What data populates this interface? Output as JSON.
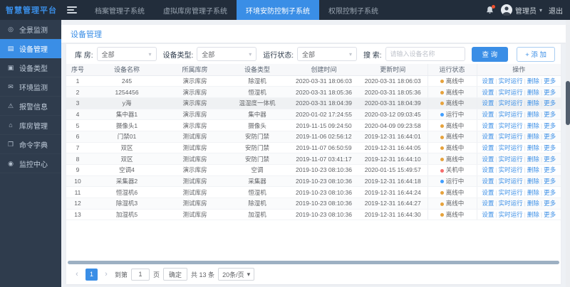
{
  "topbar": {
    "logo": "智慧管理平台",
    "tabs": [
      {
        "label": "档案管理子系统",
        "active": false
      },
      {
        "label": "虚拟库房管理子系统",
        "active": false
      },
      {
        "label": "环境安防控制子系统",
        "active": true
      },
      {
        "label": "权限控制子系统",
        "active": false
      }
    ],
    "user_name": "管理员",
    "caret": "▾",
    "logout": "退出"
  },
  "sidebar": {
    "items": [
      {
        "label": "全景监测",
        "icon": "panorama-icon",
        "glyph": "◎",
        "active": false
      },
      {
        "label": "设备管理",
        "icon": "device-manage-icon",
        "glyph": "▤",
        "active": true
      },
      {
        "label": "设备类型",
        "icon": "device-type-icon",
        "glyph": "▣",
        "active": false
      },
      {
        "label": "环境监测",
        "icon": "environment-icon",
        "glyph": "✉",
        "active": false
      },
      {
        "label": "报警信息",
        "icon": "alarm-icon",
        "glyph": "⚠",
        "active": false
      },
      {
        "label": "库房管理",
        "icon": "warehouse-icon",
        "glyph": "⌂",
        "active": false
      },
      {
        "label": "命令字典",
        "icon": "command-dict-icon",
        "glyph": "❐",
        "active": false
      },
      {
        "label": "监控中心",
        "icon": "monitor-center-icon",
        "glyph": "◉",
        "active": false
      }
    ]
  },
  "page": {
    "title": "设备管理"
  },
  "filters": {
    "warehouse_label": "库 房:",
    "warehouse_value": "全部",
    "type_label": "设备类型:",
    "type_value": "全部",
    "status_label": "运行状态:",
    "status_value": "全部",
    "search_label": "搜 索:",
    "search_placeholder": "请输入设备名称",
    "caret": "▾",
    "query_button": "查 询",
    "add_button": "+ 添 加"
  },
  "table": {
    "headers": [
      "序号",
      "设备名称",
      "所属库房",
      "设备类型",
      "创建时间",
      "更新时间",
      "运行状态",
      "操作"
    ],
    "op_labels": [
      "设置",
      "实时运行",
      "删除",
      "更多"
    ],
    "op_separator": "|",
    "status_colors": {
      "离线中": "#e6a23c",
      "运行中": "#409eff",
      "关机中": "#f56c6c"
    },
    "rows": [
      {
        "no": "1",
        "name": "245",
        "warehouse": "演示库房",
        "type": "除湿机",
        "created": "2020-03-31 18:06:03",
        "updated": "2020-03-31 18:06:03",
        "status": "离线中",
        "highlighted": false
      },
      {
        "no": "2",
        "name": "1254456",
        "warehouse": "演示库房",
        "type": "恒湿机",
        "created": "2020-03-31 18:05:36",
        "updated": "2020-03-31 18:05:36",
        "status": "离线中",
        "highlighted": false
      },
      {
        "no": "3",
        "name": "y海",
        "warehouse": "演示库房",
        "type": "温湿度一体机",
        "created": "2020-03-31 18:04:39",
        "updated": "2020-03-31 18:04:39",
        "status": "离线中",
        "highlighted": true
      },
      {
        "no": "4",
        "name": "集中器1",
        "warehouse": "演示库房",
        "type": "集中器",
        "created": "2020-01-02 17:24:55",
        "updated": "2020-03-12 09:03:45",
        "status": "运行中",
        "highlighted": false
      },
      {
        "no": "5",
        "name": "摄像头1",
        "warehouse": "演示库房",
        "type": "摄像头",
        "created": "2019-11-15 09:24:50",
        "updated": "2020-04-09 09:23:58",
        "status": "离线中",
        "highlighted": false
      },
      {
        "no": "6",
        "name": "门禁01",
        "warehouse": "测试库房",
        "type": "安防门禁",
        "created": "2019-11-06 02:56:12",
        "updated": "2019-12-31 16:44:01",
        "status": "离线中",
        "highlighted": false
      },
      {
        "no": "7",
        "name": "双区",
        "warehouse": "测试库房",
        "type": "安防门禁",
        "created": "2019-11-07 06:50:59",
        "updated": "2019-12-31 16:44:05",
        "status": "离线中",
        "highlighted": false
      },
      {
        "no": "8",
        "name": "双区",
        "warehouse": "测试库房",
        "type": "安防门禁",
        "created": "2019-11-07 03:41:17",
        "updated": "2019-12-31 16:44:10",
        "status": "离线中",
        "highlighted": false
      },
      {
        "no": "9",
        "name": "空调4",
        "warehouse": "演示库房",
        "type": "空调",
        "created": "2019-10-23 08:10:36",
        "updated": "2020-01-15 15:49:57",
        "status": "关机中",
        "highlighted": false
      },
      {
        "no": "10",
        "name": "采集器2",
        "warehouse": "测试库房",
        "type": "采集器",
        "created": "2019-10-23 08:10:36",
        "updated": "2019-12-31 16:44:18",
        "status": "运行中",
        "highlighted": false
      },
      {
        "no": "11",
        "name": "恒湿机6",
        "warehouse": "测试库房",
        "type": "恒湿机",
        "created": "2019-10-23 08:10:36",
        "updated": "2019-12-31 16:44:24",
        "status": "离线中",
        "highlighted": false
      },
      {
        "no": "12",
        "name": "除湿机3",
        "warehouse": "测试库房",
        "type": "除湿机",
        "created": "2019-10-23 08:10:36",
        "updated": "2019-12-31 16:44:27",
        "status": "离线中",
        "highlighted": false
      },
      {
        "no": "13",
        "name": "加湿机5",
        "warehouse": "测试库房",
        "type": "加湿机",
        "created": "2019-10-23 08:10:36",
        "updated": "2019-12-31 16:44:30",
        "status": "离线中",
        "highlighted": false
      }
    ]
  },
  "pagination": {
    "prev": "‹",
    "current_page": "1",
    "next": "›",
    "goto_label": "到第",
    "goto_value": "1",
    "page_unit": "页",
    "confirm": "确定",
    "total": "共 13 条",
    "page_size": "20条/页",
    "caret": "▾"
  }
}
